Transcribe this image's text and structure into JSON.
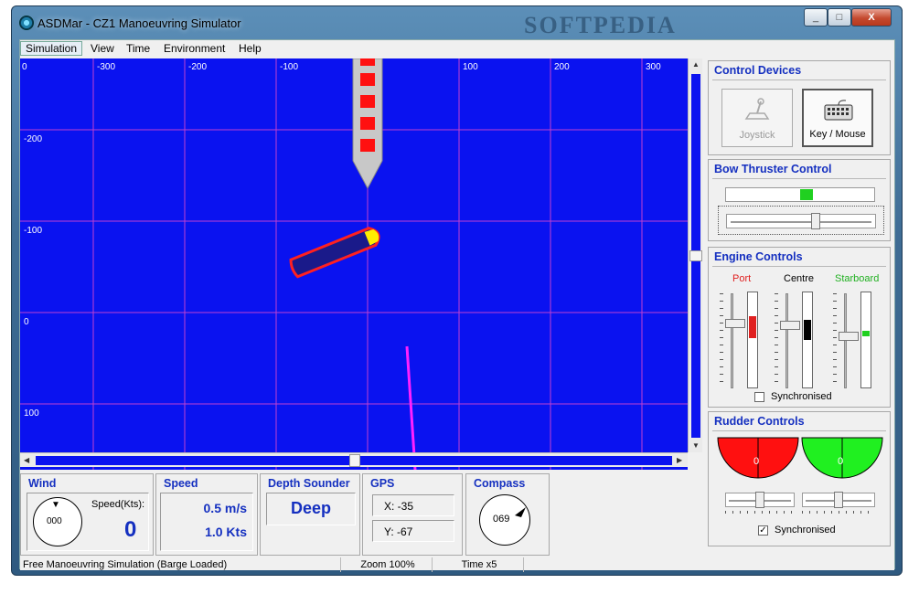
{
  "window": {
    "title": "ASDMar - CZ1 Manoeuvring Simulator",
    "watermark": "SOFTPEDIA",
    "minimize_glyph": "_",
    "maximize_glyph": "□",
    "close_glyph": "X"
  },
  "menu": [
    {
      "label": "Simulation"
    },
    {
      "label": "View"
    },
    {
      "label": "Time"
    },
    {
      "label": "Environment"
    },
    {
      "label": "Help"
    }
  ],
  "map": {
    "background": "#0a12f0",
    "grid_color": "#c040d0",
    "x_ticks": [
      "0",
      "-300",
      "-200",
      "-100",
      "100",
      "200",
      "300"
    ],
    "y_ticks": [
      "-200",
      "-100",
      "0",
      "100"
    ]
  },
  "control_devices": {
    "title": "Control Devices",
    "joystick_label": "Joystick",
    "keymouse_label": "Key / Mouse"
  },
  "bow_thruster": {
    "title": "Bow Thruster Control",
    "level_fraction": 0.5
  },
  "engine": {
    "title": "Engine Controls",
    "port_label": "Port",
    "centre_label": "Centre",
    "starboard_label": "Starboard",
    "synchronised_label": "Synchronised",
    "port_color": "#e02020",
    "centre_color": "#000000",
    "starboard_color": "#20d020"
  },
  "rudder": {
    "title": "Rudder Controls",
    "port_value": "0",
    "starboard_value": "0",
    "synchronised_label": "Synchronised",
    "synchronised_checked": "✓"
  },
  "wind": {
    "title": "Wind",
    "speed_label": "Speed(Kts):",
    "direction": "000",
    "speed": "0"
  },
  "speed": {
    "title": "Speed",
    "ms_value": "0.5 m/s",
    "kts_value": "1.0 Kts"
  },
  "depth": {
    "title": "Depth Sounder",
    "value": "Deep"
  },
  "gps": {
    "title": "GPS",
    "x": "X:  -35",
    "y": "Y:  -67"
  },
  "compass": {
    "title": "Compass",
    "heading": "069"
  },
  "status": {
    "mode": "Free Manoeuvring Simulation (Barge Loaded)",
    "zoom": "Zoom 100%",
    "time": "Time x5"
  }
}
